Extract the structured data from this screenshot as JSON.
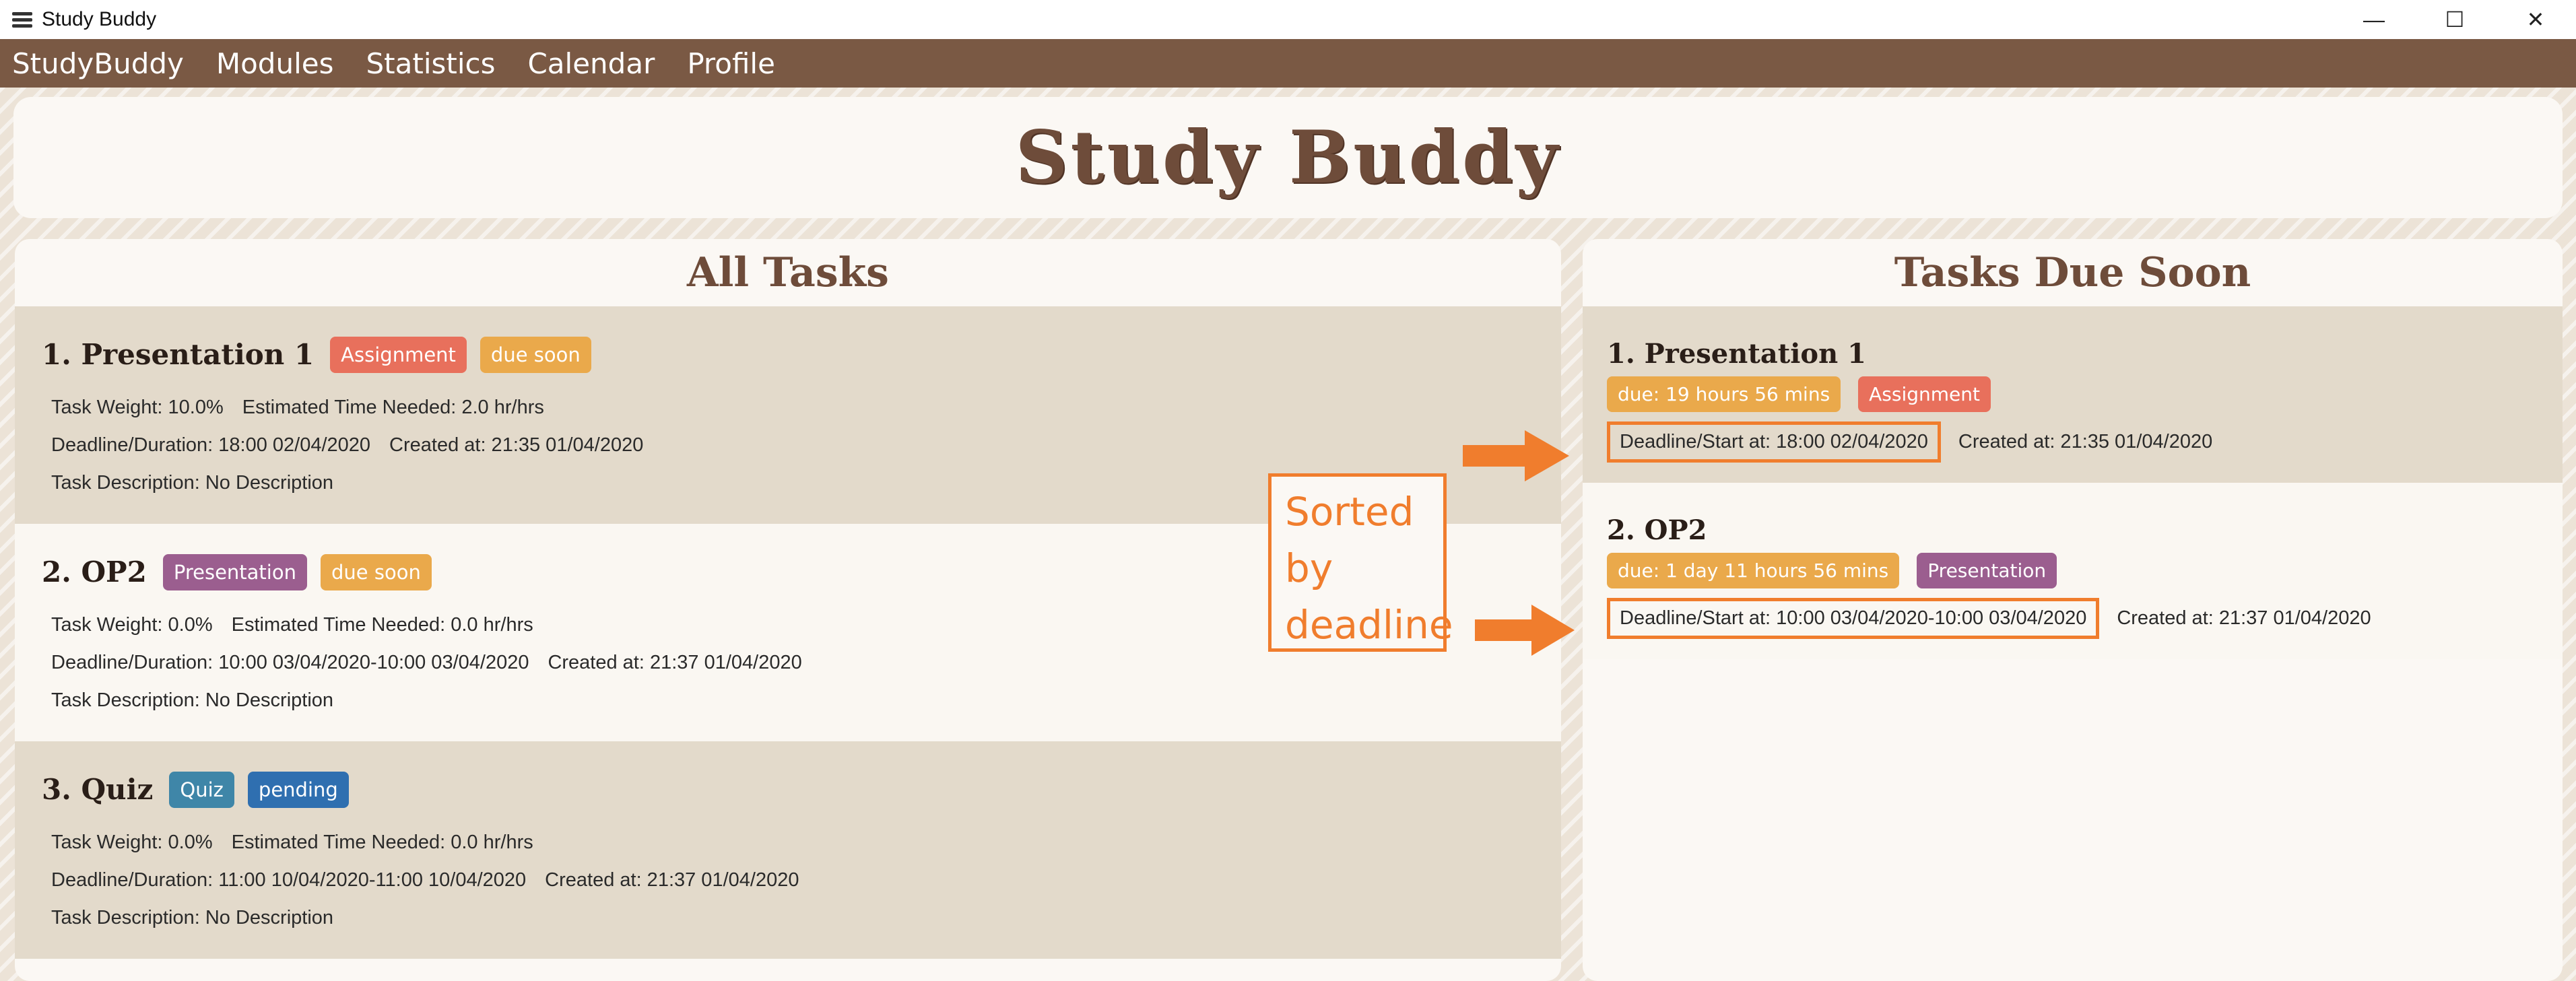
{
  "window": {
    "title": "Study Buddy",
    "controls": [
      "—",
      "☐",
      "✕"
    ]
  },
  "menu": {
    "items": [
      "StudyBuddy",
      "Modules",
      "Statistics",
      "Calendar",
      "Profile"
    ]
  },
  "header": {
    "brand": "Study Buddy"
  },
  "all_tasks": {
    "heading": "All Tasks",
    "tasks": [
      {
        "title": "1.  Presentation 1",
        "badges": [
          "Assignment",
          "due soon"
        ],
        "weight": "Task Weight: 10.0%",
        "estimate": "Estimated Time Needed: 2.0 hr/hrs",
        "deadline": "Deadline/Duration: 18:00 02/04/2020",
        "created": "Created at: 21:35 01/04/2020",
        "description": "Task Description: No Description"
      },
      {
        "title": "2.  OP2",
        "badges": [
          "Presentation",
          "due soon"
        ],
        "weight": "Task Weight: 0.0%",
        "estimate": "Estimated Time Needed: 0.0 hr/hrs",
        "deadline": "Deadline/Duration: 10:00 03/04/2020-10:00 03/04/2020",
        "created": "Created at: 21:37 01/04/2020",
        "description": "Task Description: No Description"
      },
      {
        "title": "3.  Quiz",
        "badges": [
          "Quiz",
          "pending"
        ],
        "weight": "Task Weight: 0.0%",
        "estimate": "Estimated Time Needed: 0.0 hr/hrs",
        "deadline": "Deadline/Duration: 11:00 10/04/2020-11:00 10/04/2020",
        "created": "Created at: 21:37 01/04/2020",
        "description": "Task Description: No Description"
      }
    ]
  },
  "due_soon": {
    "heading": "Tasks Due Soon",
    "tasks": [
      {
        "title": "1.  Presentation 1",
        "badges": [
          "due: 19 hours 56 mins",
          "Assignment"
        ],
        "deadline": "Deadline/Start at: 18:00 02/04/2020",
        "created": "Created at: 21:35 01/04/2020"
      },
      {
        "title": "2.  OP2",
        "badges": [
          "due: 1 day 11 hours 56 mins",
          "Presentation"
        ],
        "deadline": "Deadline/Start at: 10:00 03/04/2020-10:00 03/04/2020",
        "created": "Created at: 21:37 01/04/2020"
      }
    ]
  },
  "annotation": {
    "lines": [
      "Sorted",
      "by",
      "deadline"
    ],
    "color": "#f07d2d"
  },
  "colors": {
    "menubar": "#7a5944",
    "brand": "#6e4c3a",
    "assignment": "#e8705c",
    "due_soon": "#eaa94b",
    "presentation": "#9b5e8f",
    "quiz": "#3f86a8",
    "pending": "#2f6fb0"
  }
}
